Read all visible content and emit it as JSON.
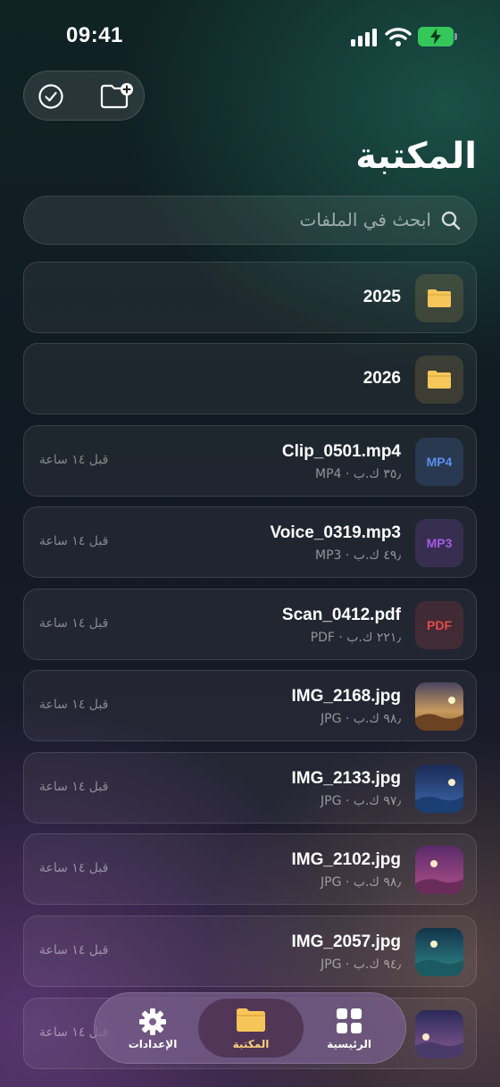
{
  "status_bar": {
    "time": "09:41"
  },
  "header": {
    "title": "المكتبة"
  },
  "search": {
    "placeholder": "ابحث في الملفات"
  },
  "items": [
    {
      "kind": "folder",
      "name": "2025"
    },
    {
      "kind": "folder",
      "name": "2026"
    },
    {
      "kind": "file",
      "name": "Clip_0501.mp4",
      "meta": "٣٥٫ ك.ب · MP4",
      "time": "قبل ١٤ ساعة",
      "badge": "MP4"
    },
    {
      "kind": "file",
      "name": "Voice_0319.mp3",
      "meta": "٤٩٫ ك.ب · MP3",
      "time": "قبل ١٤ ساعة",
      "badge": "MP3"
    },
    {
      "kind": "file",
      "name": "Scan_0412.pdf",
      "meta": "٢٢١٫ ك.ب · PDF",
      "time": "قبل ١٤ ساعة",
      "badge": "PDF"
    },
    {
      "kind": "image",
      "name": "IMG_2168.jpg",
      "meta": "٩٨٫ ك.ب · JPG",
      "time": "قبل ١٤ ساعة"
    },
    {
      "kind": "image",
      "name": "IMG_2133.jpg",
      "meta": "٩٧٫ ك.ب · JPG",
      "time": "قبل ١٤ ساعة"
    },
    {
      "kind": "image",
      "name": "IMG_2102.jpg",
      "meta": "٩٨٫ ك.ب · JPG",
      "time": "قبل ١٤ ساعة"
    },
    {
      "kind": "image",
      "name": "IMG_2057.jpg",
      "meta": "٩٤٫ ك.ب · JPG",
      "time": "قبل ١٤ ساعة"
    },
    {
      "kind": "image",
      "name": "",
      "meta": "",
      "time": "قبل ١٤ ساعة"
    }
  ],
  "tabbar": {
    "settings_label": "الإعدادات",
    "library_label": "المكتبة",
    "home_label": "الرئيسية"
  },
  "colors": {
    "accent_green": "#34c759",
    "folder_yellow": "#f7c65a",
    "mp4_blue": "#5b8ff0",
    "mp3_purple": "#a45be6",
    "pdf_red": "#e84a4a"
  },
  "icons": {
    "select": "checkmark-circle-icon",
    "new_folder": "folder-plus-icon",
    "search": "search-icon",
    "folder": "folder-icon",
    "settings": "gear-icon",
    "home": "grid-icon"
  }
}
